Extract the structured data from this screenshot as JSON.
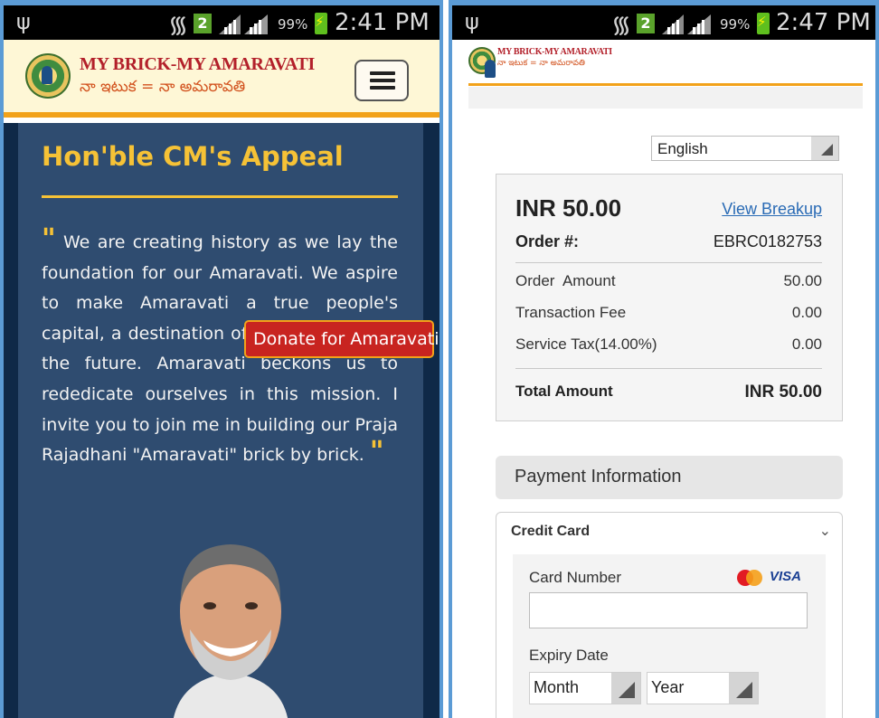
{
  "colors": {
    "frame_border": "#5b9bd5",
    "accent_orange": "#f2a21a",
    "brand_red": "#b3202a",
    "title_yellow": "#f6c236",
    "panel_blue": "#2f4c70",
    "donate_red": "#c82420",
    "link_blue": "#2a6bb5"
  },
  "left": {
    "status": {
      "sim_slot": "2",
      "battery": "99%",
      "time": "2:41 PM"
    },
    "brand": {
      "name_en": "MY BRICK-MY AMARAVATI",
      "name_te": "నా ఇటుక = నా అమరావతి"
    },
    "appeal": {
      "title": "Hon'ble CM's Appeal",
      "quote_open": "\"",
      "quote": "We are creating history as we lay the foundation for our Amaravati. We aspire to make Amaravati a true people's capital, a destination of opportunities for the future. Amaravati beckons us to rededicate ourselves in this mission. I invite you to join me in building our Praja Rajadhani \"Amaravati\" brick by brick.",
      "quote_close": "\""
    },
    "donate_label": "Donate for Amaravati",
    "icons": [
      "usb-icon",
      "wifi-icon",
      "signal-icon",
      "battery-icon",
      "emblem-icon",
      "menu-icon"
    ]
  },
  "right": {
    "status": {
      "sim_slot": "2",
      "battery": "99%",
      "time": "2:47 PM"
    },
    "brand": {
      "name_en": "MY BRICK-MY AMARAVATI",
      "name_te": "నా ఇటుక = నా అమరావతి"
    },
    "language": "English",
    "summary": {
      "amount": "INR 50.00",
      "breakup_link": "View Breakup",
      "order_label": "Order #:",
      "order_number": "EBRC0182753",
      "rows": [
        {
          "label": "Order  Amount",
          "value": "50.00"
        },
        {
          "label": "Transaction Fee",
          "value": "0.00"
        },
        {
          "label": "Service Tax(14.00%)",
          "value": "0.00"
        }
      ],
      "total_label": "Total Amount",
      "total_value": "INR 50.00"
    },
    "payment": {
      "heading": "Payment Information",
      "method": "Credit Card",
      "card_number_label": "Card Number",
      "card_number_value": "",
      "card_brand": "VISA",
      "expiry_label": "Expiry Date",
      "month": "Month",
      "year": "Year"
    }
  }
}
